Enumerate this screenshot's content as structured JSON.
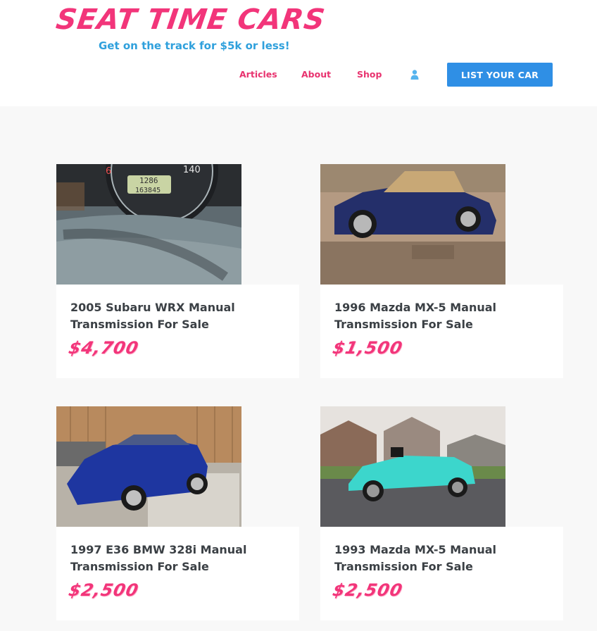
{
  "site": {
    "logo_title": "SEAT TIME CARS",
    "tagline": "Get on the track for $5k or less!"
  },
  "nav": {
    "items": [
      {
        "label": "Articles"
      },
      {
        "label": "About"
      },
      {
        "label": "Shop"
      }
    ],
    "user_icon": "user-icon",
    "cta_label": "LIST YOUR CAR"
  },
  "colors": {
    "brand_pink": "#f2357a",
    "brand_blue": "#2fa0dc",
    "cta_blue": "#2f8fe5"
  },
  "listings": [
    {
      "title": "2005 Subaru WRX Manual Transmission For Sale",
      "price": "$4,700",
      "image": "dashboard-odometer-photo"
    },
    {
      "title": "1996 Mazda MX-5 Manual Transmission For Sale",
      "price": "$1,500",
      "image": "blue-miata-photo"
    },
    {
      "title": "1997 E36 BMW 328i Manual Transmission For Sale",
      "price": "$2,500",
      "image": "blue-bmw-sedan-photo"
    },
    {
      "title": "1993 Mazda MX-5 Manual Transmission For Sale",
      "price": "$2,500",
      "image": "teal-miata-photo"
    }
  ]
}
